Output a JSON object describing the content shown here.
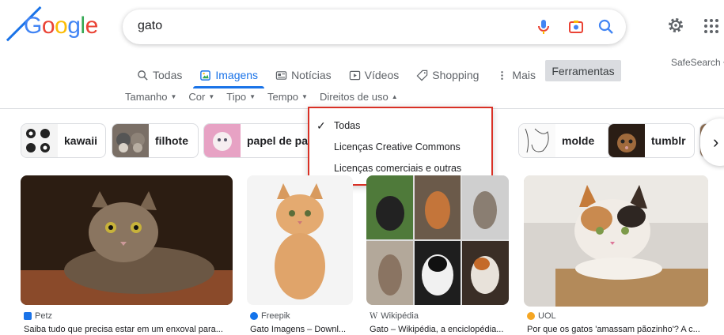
{
  "header": {
    "logo": [
      "G",
      "o",
      "o",
      "g",
      "l",
      "e"
    ],
    "logo_colors": [
      "#4285F4",
      "#EA4335",
      "#FBBC05",
      "#4285F4",
      "#34A853",
      "#EA4335"
    ],
    "search_query": "gato"
  },
  "tabs": [
    {
      "label": "Todas",
      "icon": "search-icon",
      "active": false
    },
    {
      "label": "Imagens",
      "icon": "image-icon",
      "active": true
    },
    {
      "label": "Notícias",
      "icon": "news-icon",
      "active": false
    },
    {
      "label": "Vídeos",
      "icon": "play-icon",
      "active": false
    },
    {
      "label": "Shopping",
      "icon": "tag-icon",
      "active": false
    },
    {
      "label": "Mais",
      "icon": "more-vert-icon",
      "active": false
    }
  ],
  "tools_label": "Ferramentas",
  "safesearch_label": "SafeSearch",
  "filters": [
    "Tamanho",
    "Cor",
    "Tipo",
    "Tempo",
    "Direitos de uso"
  ],
  "chips": [
    "kawaii",
    "filhote",
    "papel de pare",
    "molde",
    "tumblr"
  ],
  "dropdown": {
    "items": [
      "Todas",
      "Licenças Creative Commons",
      "Licenças comerciais e outras"
    ],
    "selected": "Todas"
  },
  "results": [
    {
      "source": "Petz",
      "title": "Saiba tudo que precisa estar em um enxoval para..."
    },
    {
      "source": "Freepik",
      "title": "Gato Imagens – Downl..."
    },
    {
      "source": "Wikipédia",
      "title": "Gato – Wikipédia, a enciclopédia..."
    },
    {
      "source": "UOL",
      "title": "Por que os gatos 'amassam pãozinho'? A c..."
    }
  ],
  "colors": {
    "accent": "#1a73e8",
    "highlight_border": "#d93025",
    "tools_bg": "#dadce0"
  }
}
